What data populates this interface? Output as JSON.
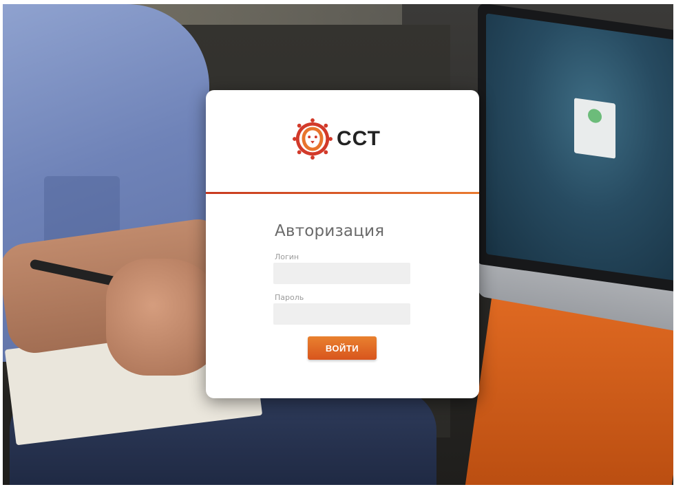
{
  "brand": {
    "name": "ССТ",
    "accent_color": "#d8551d",
    "divider_gradient": [
      "#c8391f",
      "#e97a2f"
    ],
    "icon": "lion-sun-logo-icon"
  },
  "form": {
    "title": "Авторизация",
    "login_label": "Логин",
    "login_value": "",
    "password_label": "Пароль",
    "password_value": "",
    "submit_label": "ВОЙТИ"
  }
}
